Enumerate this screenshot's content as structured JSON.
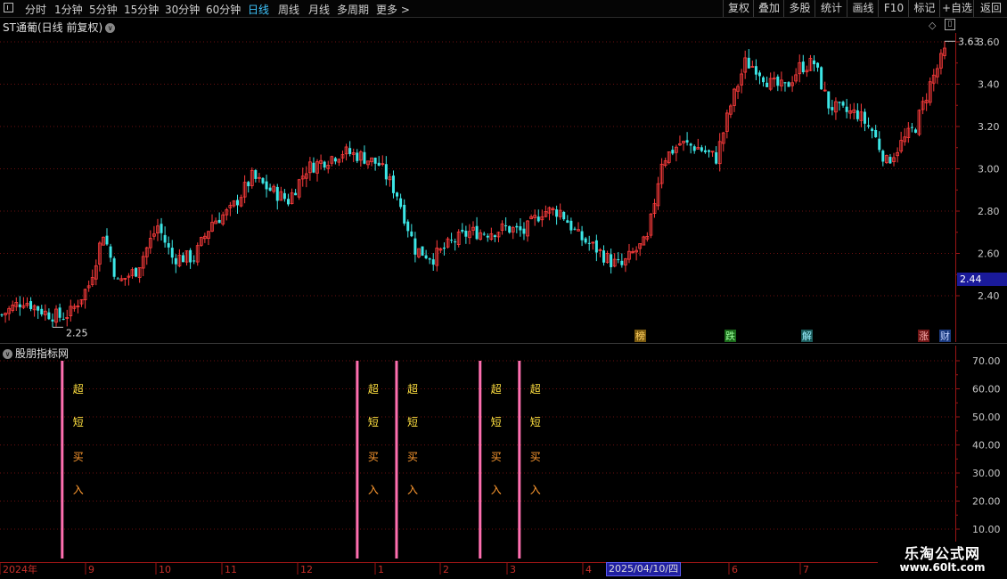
{
  "toolbar": {
    "left_items": [
      "分时",
      "1分钟",
      "5分钟",
      "15分钟",
      "30分钟",
      "60分钟",
      "日线",
      "周线",
      "月线",
      "多周期",
      "更多 >"
    ],
    "active_item": "日线",
    "right_items": [
      "复权",
      "叠加",
      "多股",
      "统计",
      "画线",
      "F10",
      "标记",
      "+自选",
      "返回"
    ]
  },
  "main_chart": {
    "title": "ST通葡(日线 前复权)",
    "current_price_tag": "2.44",
    "high_label": "3.63",
    "low_label": "2.25",
    "event_labels": [
      "榜",
      "跌",
      "解",
      "涨",
      "财"
    ]
  },
  "indicator": {
    "title": "股朋指标网",
    "signal_chars": [
      "超",
      "短",
      "买",
      "入"
    ]
  },
  "time_axis": {
    "labels": [
      "2024年",
      "9",
      "10",
      "11",
      "12",
      "1",
      "2",
      "3",
      "4",
      "6",
      "7"
    ],
    "highlight": "2025/04/10/四"
  },
  "watermark": {
    "line1": "乐淘公式网",
    "line2": "www.60lt.com"
  },
  "colors": {
    "background": "#000000",
    "up_candle": "#ff3c3c",
    "down_candle": "#3ce6e6",
    "axis": "#9a1515",
    "grid": "#6a0f0f",
    "signal_bar": "#ff6fb0",
    "signal_text_top": "#ffe040",
    "signal_text_bottom": "#ff9a30",
    "active_tab": "#3fc6ff"
  },
  "chart_data": [
    {
      "type": "candlestick",
      "title": "ST通葡(日线 前复权)",
      "ylim": [
        2.2,
        3.72
      ],
      "y_ticks": [
        2.4,
        2.6,
        2.8,
        3.0,
        3.2,
        3.4,
        3.6
      ],
      "grid": true,
      "annotations": [
        {
          "text": "3.63",
          "type": "high"
        },
        {
          "text": "2.25",
          "type": "low"
        }
      ],
      "close_anchors": [
        [
          0,
          2.31
        ],
        [
          6,
          2.38
        ],
        [
          12,
          2.32
        ],
        [
          16,
          2.3
        ],
        [
          19,
          2.32
        ],
        [
          24,
          2.45
        ],
        [
          28,
          2.7
        ],
        [
          32,
          2.46
        ],
        [
          37,
          2.52
        ],
        [
          43,
          2.73
        ],
        [
          47,
          2.58
        ],
        [
          53,
          2.58
        ],
        [
          58,
          2.75
        ],
        [
          63,
          2.8
        ],
        [
          69,
          2.96
        ],
        [
          74,
          2.9
        ],
        [
          79,
          2.85
        ],
        [
          84,
          3.0
        ],
        [
          89,
          3.04
        ],
        [
          94,
          3.08
        ],
        [
          99,
          3.06
        ],
        [
          104,
          3.02
        ],
        [
          109,
          2.88
        ],
        [
          114,
          2.62
        ],
        [
          119,
          2.58
        ],
        [
          124,
          2.65
        ],
        [
          129,
          2.7
        ],
        [
          134,
          2.7
        ],
        [
          139,
          2.72
        ],
        [
          144,
          2.7
        ],
        [
          149,
          2.8
        ],
        [
          154,
          2.8
        ],
        [
          159,
          2.68
        ],
        [
          164,
          2.62
        ],
        [
          168,
          2.56
        ],
        [
          171,
          2.54
        ],
        [
          174,
          2.6
        ],
        [
          178,
          2.66
        ],
        [
          182,
          3.04
        ],
        [
          187,
          3.12
        ],
        [
          192,
          3.1
        ],
        [
          197,
          3.05
        ],
        [
          201,
          3.3
        ],
        [
          205,
          3.5
        ],
        [
          208,
          3.48
        ],
        [
          212,
          3.4
        ],
        [
          216,
          3.38
        ],
        [
          220,
          3.48
        ],
        [
          224,
          3.5
        ],
        [
          228,
          3.3
        ],
        [
          232,
          3.27
        ],
        [
          236,
          3.26
        ],
        [
          240,
          3.18
        ],
        [
          244,
          3.03
        ],
        [
          248,
          3.12
        ],
        [
          252,
          3.2
        ],
        [
          256,
          3.4
        ],
        [
          260,
          3.55
        ]
      ],
      "volatility": 0.035
    },
    {
      "type": "bar",
      "title": "股朋指标网",
      "ylim": [
        10.0,
        72.0
      ],
      "y_ticks": [
        10.0,
        20.0,
        30.0,
        40.0,
        50.0,
        60.0,
        70.0
      ],
      "signal_positions": [
        0.06,
        0.353,
        0.392,
        0.475,
        0.514
      ],
      "signal_label": "超短买入"
    }
  ]
}
